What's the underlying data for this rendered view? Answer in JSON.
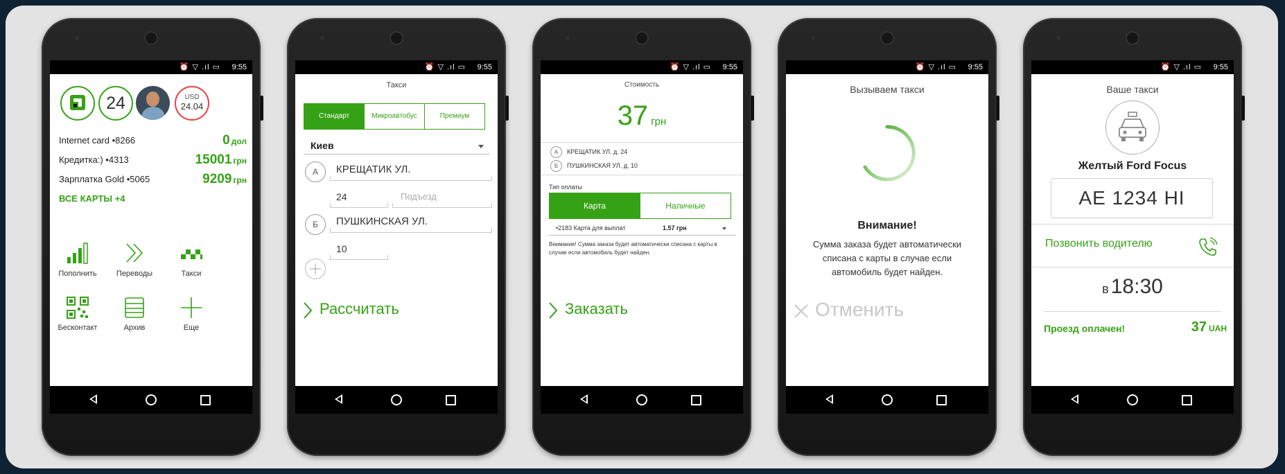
{
  "status_bar": {
    "icons": "⏰ ▽ .ıl ▭",
    "time": "9:55"
  },
  "colors": {
    "brand_green": "#35a215",
    "usd_red": "#e4423f",
    "background": "#e3e3e3"
  },
  "screen1": {
    "logo_icon": "privatbank-logo-icon",
    "badge_24": "24",
    "usd_label": "USD",
    "usd_rate": "24.04",
    "cards": [
      {
        "name": "Internet card •8266",
        "amount": "0",
        "currency": "дол"
      },
      {
        "name": "Кредитка:) •4313",
        "amount": "15001",
        "currency": "грн"
      },
      {
        "name": "Зарплатка Gold •5065",
        "amount": "9209",
        "currency": "грн"
      }
    ],
    "all_cards": "ВСЕ КАРТЫ +4",
    "actions": [
      {
        "label": "Пополнить",
        "icon": "signal-bars-icon"
      },
      {
        "label": "Переводы",
        "icon": "double-chevron-icon"
      },
      {
        "label": "Такси",
        "icon": "taxi-checker-icon"
      },
      {
        "label": "Бесконтакт",
        "icon": "qr-code-icon"
      },
      {
        "label": "Архив",
        "icon": "archive-tray-icon"
      },
      {
        "label": "Еще",
        "icon": "plus-icon"
      }
    ]
  },
  "screen2": {
    "title": "Такси",
    "tabs": [
      "Стандарт",
      "Микроавтобус",
      "Премиум"
    ],
    "city": "Киев",
    "point_a_label": "А",
    "point_a_street": "КРЕЩАТИК УЛ.",
    "point_a_house": "24",
    "entrance_placeholder": "Подъезд",
    "point_b_label": "Б",
    "point_b_street": "ПУШКИНСКАЯ УЛ.",
    "point_b_house": "10",
    "calculate": "Рассчитать"
  },
  "screen3": {
    "title": "Стоимость",
    "price": "37",
    "price_currency": "грн",
    "route_a_label": "А",
    "route_a": "КРЕЩАТИК УЛ. д. 24",
    "route_b_label": "Б",
    "route_b": "ПУШКИНСКАЯ УЛ. д. 10",
    "payment_type": "Тип оплаты",
    "pay_options": [
      "Карта",
      "Наличные"
    ],
    "card_select": "•2183 Карта для выплат",
    "card_balance": "1.57 грн",
    "warning": "Внимание! Сумма заказа будет автоматически списана с карты в случае если автомобиль будет найден.",
    "order": "Заказать"
  },
  "screen4": {
    "title": "Вызываем такси",
    "attention": "Внимание!",
    "message": "Сумма заказа будет автоматически списана с карты в случае если автомобиль будет найден.",
    "cancel": "Отменить"
  },
  "screen5": {
    "title": "Ваше такси",
    "car": "Желтый Ford Focus",
    "plate": "AE 1234 HI",
    "call_driver": "Позвонить водителю",
    "time_prefix": "в",
    "time": "18:30",
    "paid": "Проезд оплачен!",
    "amount": "37",
    "amount_currency": "UAH"
  }
}
